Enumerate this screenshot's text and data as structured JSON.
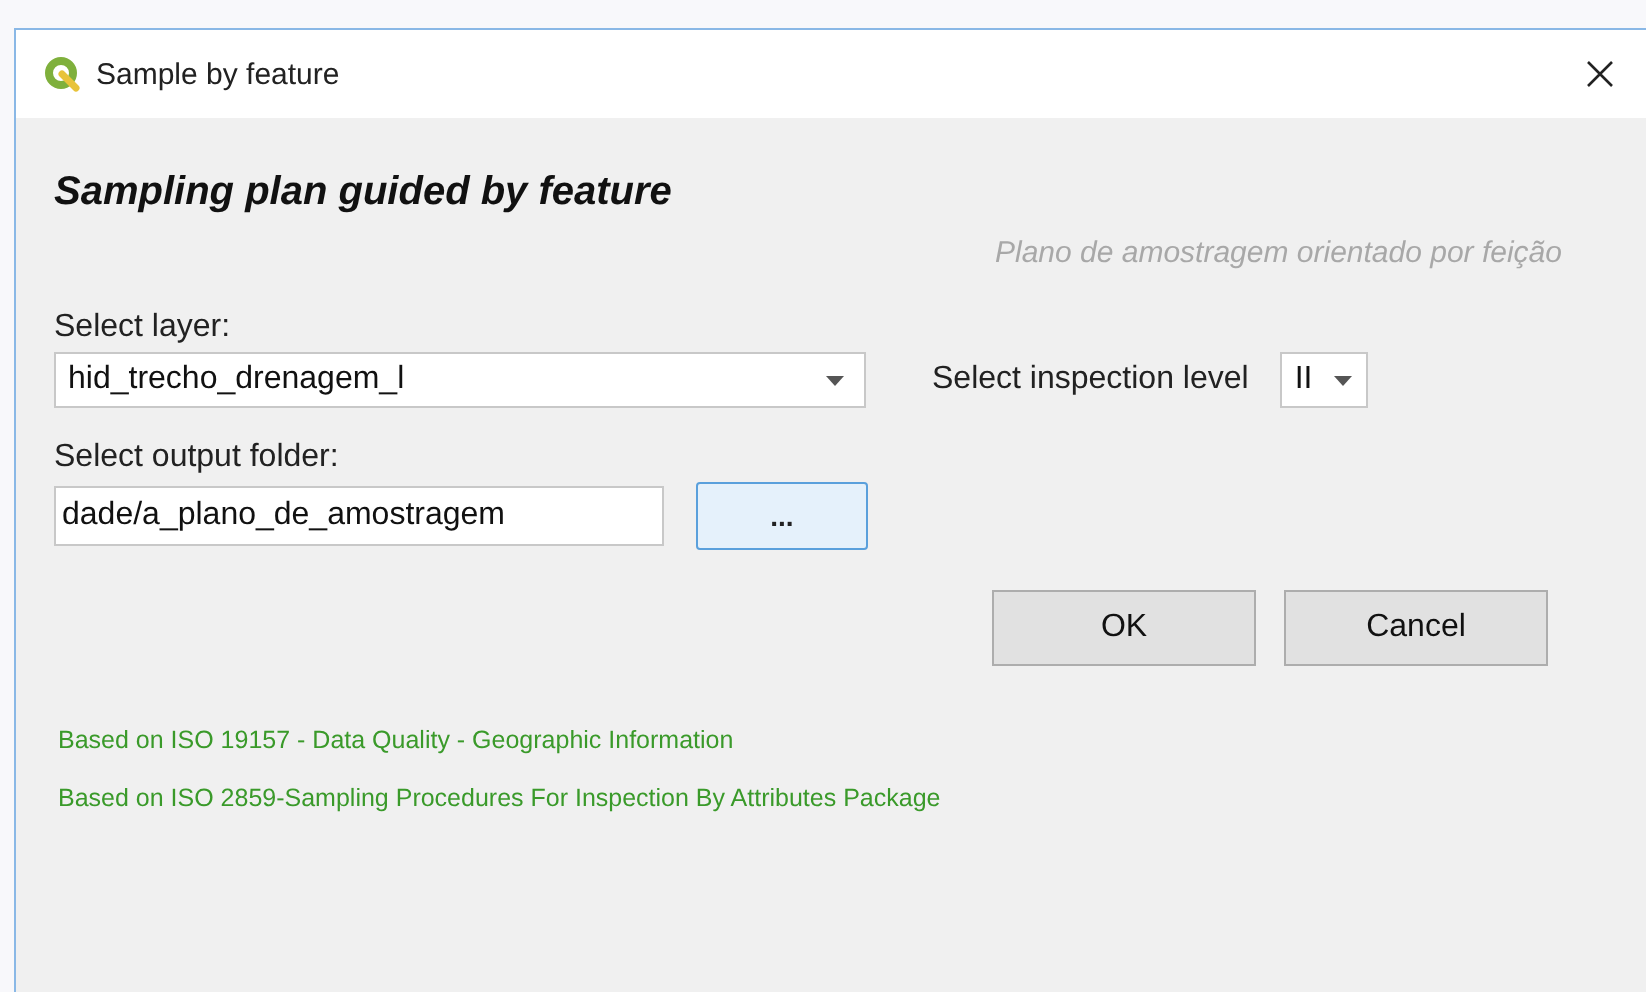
{
  "window": {
    "title": "Sample by feature"
  },
  "heading": "Sampling plan guided by feature",
  "subtitle": "Plano de amostragem orientado por feição",
  "layer": {
    "label": "Select layer:",
    "value": "hid_trecho_drenagem_l"
  },
  "inspection": {
    "label": "Select inspection level",
    "value": "II"
  },
  "output": {
    "label": "Select output folder:",
    "value": "dade/a_plano_de_amostragem",
    "browse": "..."
  },
  "buttons": [
    "OK",
    "Cancel"
  ],
  "notes": [
    "Based on ISO 19157 - Data Quality - Geographic Information",
    "Based on ISO 2859-Sampling Procedures For Inspection By Attributes Package"
  ]
}
